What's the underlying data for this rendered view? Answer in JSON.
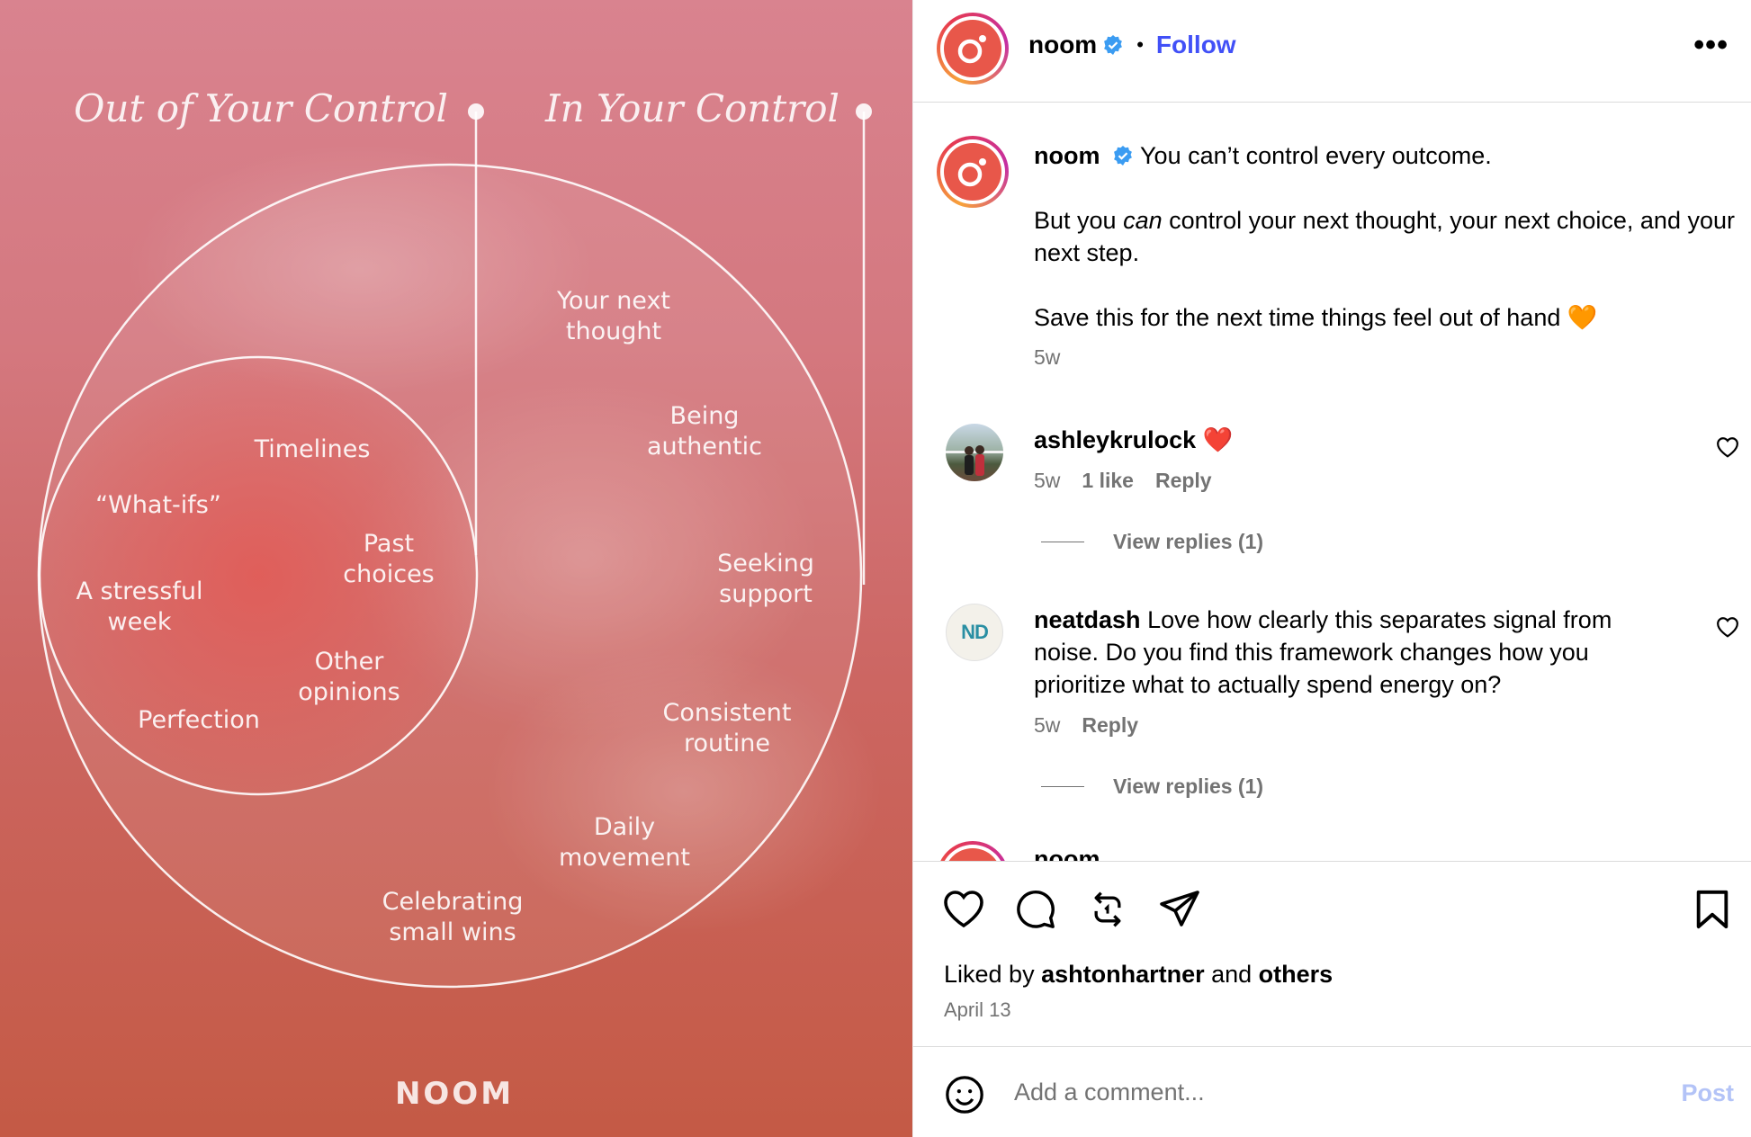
{
  "image": {
    "heading_left": "Out of Your Control",
    "heading_right": "In Your Control",
    "out_items": [
      "Timelines",
      "“What-ifs”",
      "Past\nchoices",
      "A stressful\nweek",
      "Other\nopinions",
      "Perfection"
    ],
    "in_items": [
      "Your next\nthought",
      "Being\nauthentic",
      "Seeking\nsupport",
      "Consistent\nroutine",
      "Daily\nmovement",
      "Celebrating\nsmall wins"
    ],
    "brand": "NOOM"
  },
  "header": {
    "username": "noom",
    "separator": "•",
    "follow_label": "Follow",
    "more_label": "•••"
  },
  "caption": {
    "username": "noom",
    "line1": "You can’t control every outcome.",
    "line2_pre": "But you ",
    "line2_em": "can",
    "line2_post": " control your next thought, your next choice, and your next step.",
    "line3": "Save this for the next time things feel out of hand 🧡",
    "time": "5w"
  },
  "comments": [
    {
      "username": "ashleykrulock",
      "text": "❤️",
      "time": "5w",
      "likes": "1 like",
      "reply_label": "Reply",
      "view_replies": "View replies (1)"
    },
    {
      "username": "neatdash",
      "avatar_initials": "ND",
      "text": "Love how clearly this separates signal from noise. Do you find this framework changes how you prioritize what to actually spend energy on?",
      "time": "5w",
      "reply_label": "Reply",
      "view_replies": "View replies (1)"
    }
  ],
  "partial_comment": {
    "username": "noom"
  },
  "footer": {
    "liked_prefix": "Liked by ",
    "liked_user": "ashtonhartner",
    "liked_mid": " and ",
    "liked_others": "others",
    "date": "April 13",
    "comment_placeholder": "Add a comment...",
    "post_label": "Post"
  },
  "colors": {
    "follow": "#4150f7",
    "verified": "#3b9cf2",
    "brand_red": "#e8574a",
    "post_disabled": "#b3c3f7"
  }
}
